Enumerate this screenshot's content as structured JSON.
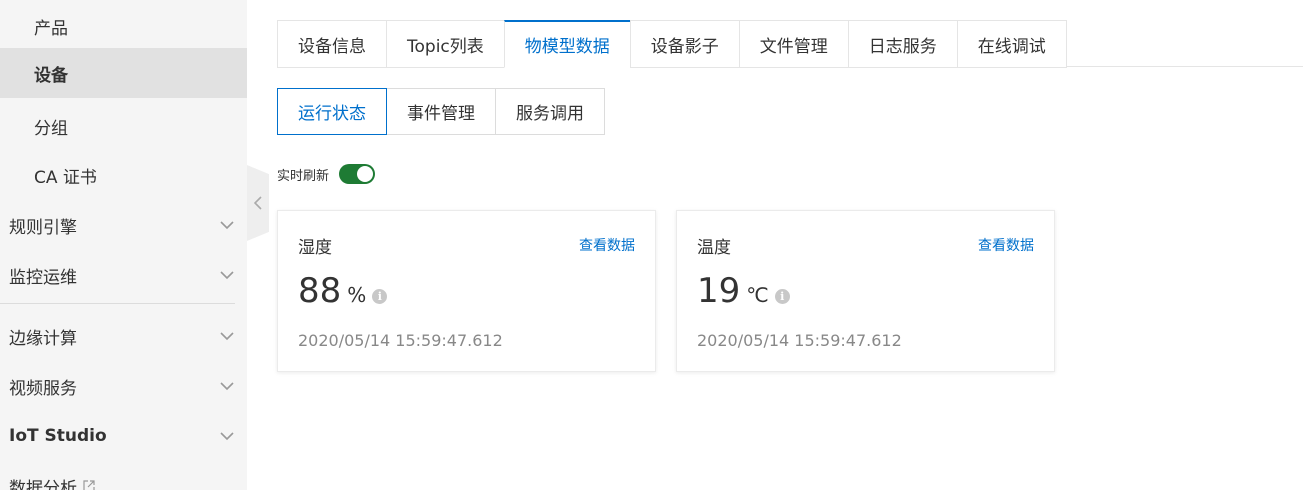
{
  "sidebar": {
    "items": [
      {
        "label": "产品"
      },
      {
        "label": "设备"
      },
      {
        "label": "分组"
      },
      {
        "label": "CA 证书"
      },
      {
        "label": "规则引擎"
      },
      {
        "label": "监控运维"
      },
      {
        "label": "边缘计算"
      },
      {
        "label": "视频服务"
      },
      {
        "label": "IoT Studio"
      },
      {
        "label": "数据分析"
      }
    ],
    "chevron_icon": "chevron-down-icon",
    "external_icon": "external-link-icon"
  },
  "collapse_icon": "chevron-left-icon",
  "tabs": [
    {
      "label": "设备信息"
    },
    {
      "label": "Topic列表"
    },
    {
      "label": "物模型数据"
    },
    {
      "label": "设备影子"
    },
    {
      "label": "文件管理"
    },
    {
      "label": "日志服务"
    },
    {
      "label": "在线调试"
    }
  ],
  "subtabs": [
    {
      "label": "运行状态"
    },
    {
      "label": "事件管理"
    },
    {
      "label": "服务调用"
    }
  ],
  "refresh": {
    "label": "实时刷新",
    "enabled": true
  },
  "cards": [
    {
      "title": "湿度",
      "link": "查看数据",
      "value": "88",
      "unit": "%",
      "info": "i",
      "time": "2020/05/14 15:59:47.612"
    },
    {
      "title": "温度",
      "link": "查看数据",
      "value": "19",
      "unit": "℃",
      "info": "i",
      "time": "2020/05/14 15:59:47.612"
    }
  ],
  "colors": {
    "accent": "#0070cc",
    "toggle_on": "#1e7b34",
    "sidebar_bg": "#f5f5f5",
    "sidebar_active": "#e1e1e1"
  }
}
